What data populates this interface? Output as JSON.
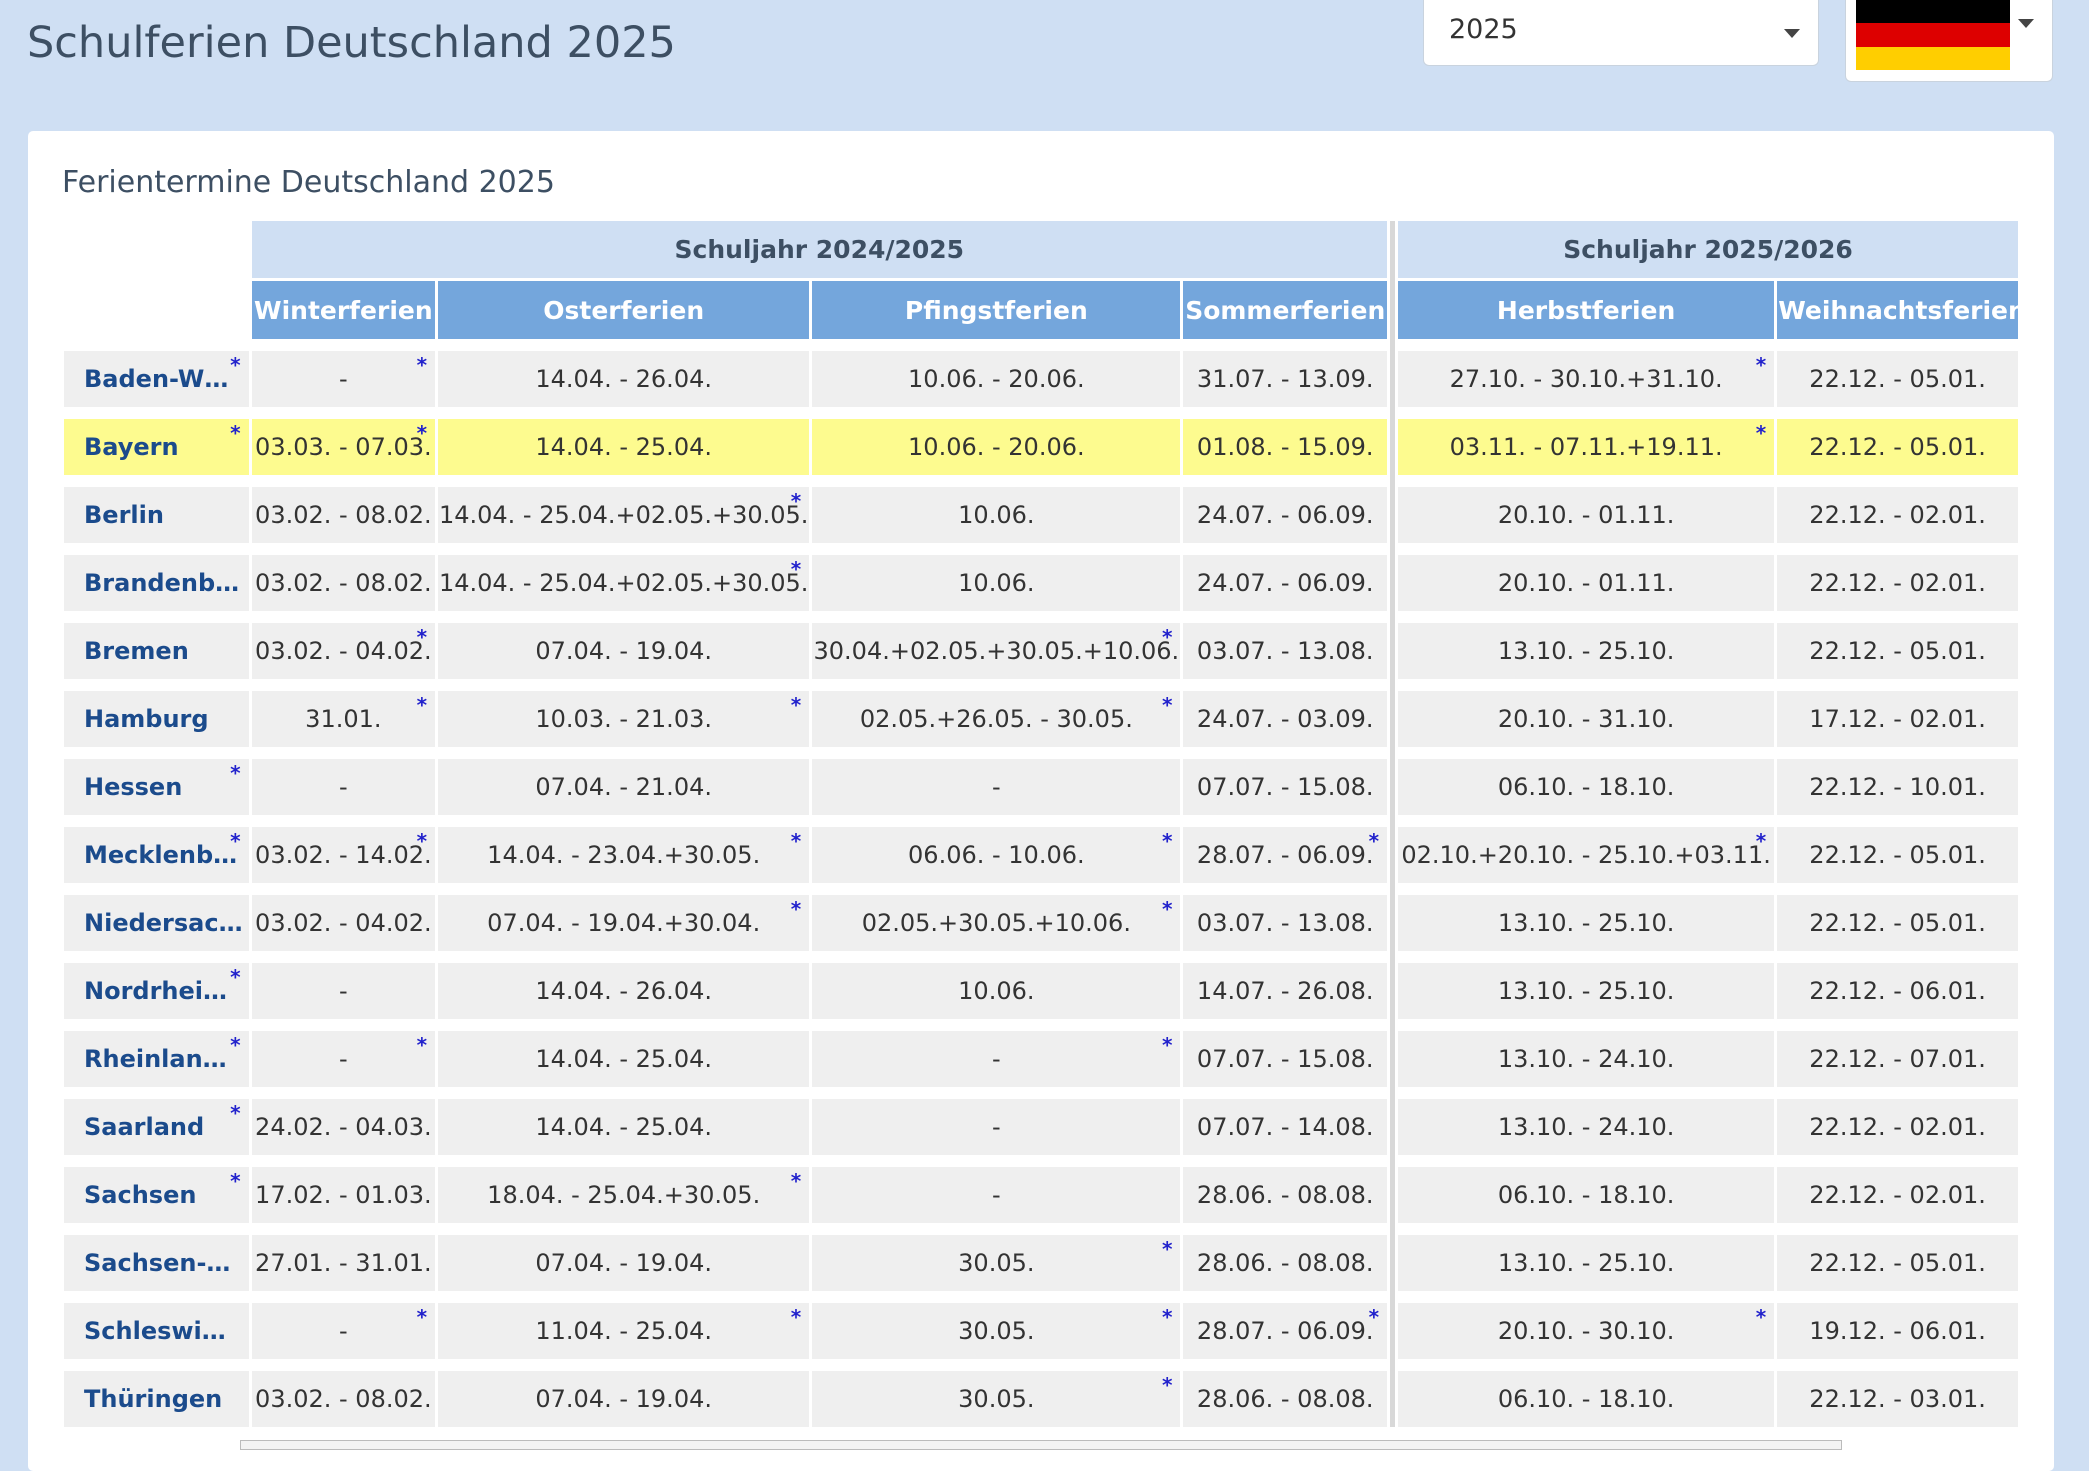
{
  "page": {
    "title": "Schulferien Deutschland 2025"
  },
  "controls": {
    "year_selected": "2025",
    "flag": {
      "colors": [
        "#000000",
        "#dd0000",
        "#ffce00"
      ]
    }
  },
  "panel": {
    "title": "Ferientermine Deutschland 2025"
  },
  "colors": {
    "header_blue": "#74a6dc",
    "year_header": "#cfdff3",
    "highlight": "#fdfb8f",
    "state_link": "#1b4b8c",
    "star": "#2222cc"
  },
  "table": {
    "year_headers": [
      "Schuljahr 2024/2025",
      "Schuljahr 2025/2026"
    ],
    "columns": [
      "Winterferien",
      "Osterferien",
      "Pfingstferien",
      "Sommerferien",
      "Herbstferien",
      "Weihnachtsferien"
    ],
    "rows": [
      {
        "state": "Baden-W…",
        "state_star": true,
        "highlight": false,
        "cells": [
          {
            "v": "-",
            "s": true
          },
          {
            "v": "14.04. - 26.04.",
            "s": false
          },
          {
            "v": "10.06. - 20.06.",
            "s": false
          },
          {
            "v": "31.07. - 13.09.",
            "s": false
          },
          {
            "v": "27.10. - 30.10.+31.10.",
            "s": true
          },
          {
            "v": "22.12. - 05.01.",
            "s": false
          }
        ]
      },
      {
        "state": "Bayern",
        "state_star": true,
        "highlight": true,
        "cells": [
          {
            "v": "03.03. - 07.03.",
            "s": true
          },
          {
            "v": "14.04. - 25.04.",
            "s": false
          },
          {
            "v": "10.06. - 20.06.",
            "s": false
          },
          {
            "v": "01.08. - 15.09.",
            "s": false
          },
          {
            "v": "03.11. - 07.11.+19.11.",
            "s": true
          },
          {
            "v": "22.12. - 05.01.",
            "s": false
          }
        ]
      },
      {
        "state": "Berlin",
        "state_star": false,
        "highlight": false,
        "cells": [
          {
            "v": "03.02. - 08.02.",
            "s": false
          },
          {
            "v": "14.04. - 25.04.+02.05.+30.05.",
            "s": true
          },
          {
            "v": "10.06.",
            "s": false
          },
          {
            "v": "24.07. - 06.09.",
            "s": false
          },
          {
            "v": "20.10. - 01.11.",
            "s": false
          },
          {
            "v": "22.12. - 02.01.",
            "s": false
          }
        ]
      },
      {
        "state": "Brandenb…",
        "state_star": false,
        "highlight": false,
        "cells": [
          {
            "v": "03.02. - 08.02.",
            "s": false
          },
          {
            "v": "14.04. - 25.04.+02.05.+30.05.",
            "s": true
          },
          {
            "v": "10.06.",
            "s": false
          },
          {
            "v": "24.07. - 06.09.",
            "s": false
          },
          {
            "v": "20.10. - 01.11.",
            "s": false
          },
          {
            "v": "22.12. - 02.01.",
            "s": false
          }
        ]
      },
      {
        "state": "Bremen",
        "state_star": false,
        "highlight": false,
        "cells": [
          {
            "v": "03.02. - 04.02.",
            "s": true
          },
          {
            "v": "07.04. - 19.04.",
            "s": false
          },
          {
            "v": "30.04.+02.05.+30.05.+10.06.",
            "s": true
          },
          {
            "v": "03.07. - 13.08.",
            "s": false
          },
          {
            "v": "13.10. - 25.10.",
            "s": false
          },
          {
            "v": "22.12. - 05.01.",
            "s": false
          }
        ]
      },
      {
        "state": "Hamburg",
        "state_star": false,
        "highlight": false,
        "cells": [
          {
            "v": "31.01.",
            "s": true
          },
          {
            "v": "10.03. - 21.03.",
            "s": true
          },
          {
            "v": "02.05.+26.05. - 30.05.",
            "s": true
          },
          {
            "v": "24.07. - 03.09.",
            "s": false
          },
          {
            "v": "20.10. - 31.10.",
            "s": false
          },
          {
            "v": "17.12. - 02.01.",
            "s": false
          }
        ]
      },
      {
        "state": "Hessen",
        "state_star": true,
        "highlight": false,
        "cells": [
          {
            "v": "-",
            "s": false
          },
          {
            "v": "07.04. - 21.04.",
            "s": false
          },
          {
            "v": "-",
            "s": false
          },
          {
            "v": "07.07. - 15.08.",
            "s": false
          },
          {
            "v": "06.10. - 18.10.",
            "s": false
          },
          {
            "v": "22.12. - 10.01.",
            "s": false
          }
        ]
      },
      {
        "state": "Mecklenb…",
        "state_star": true,
        "highlight": false,
        "cells": [
          {
            "v": "03.02. - 14.02.",
            "s": true
          },
          {
            "v": "14.04. - 23.04.+30.05.",
            "s": true
          },
          {
            "v": "06.06. - 10.06.",
            "s": true
          },
          {
            "v": "28.07. - 06.09.",
            "s": true
          },
          {
            "v": "02.10.+20.10. - 25.10.+03.11.",
            "s": true
          },
          {
            "v": "22.12. - 05.01.",
            "s": false
          }
        ]
      },
      {
        "state": "Niedersac…",
        "state_star": false,
        "highlight": false,
        "cells": [
          {
            "v": "03.02. - 04.02.",
            "s": false
          },
          {
            "v": "07.04. - 19.04.+30.04.",
            "s": true
          },
          {
            "v": "02.05.+30.05.+10.06.",
            "s": true
          },
          {
            "v": "03.07. - 13.08.",
            "s": false
          },
          {
            "v": "13.10. - 25.10.",
            "s": false
          },
          {
            "v": "22.12. - 05.01.",
            "s": false
          }
        ]
      },
      {
        "state": "Nordrhei…",
        "state_star": true,
        "highlight": false,
        "cells": [
          {
            "v": "-",
            "s": false
          },
          {
            "v": "14.04. - 26.04.",
            "s": false
          },
          {
            "v": "10.06.",
            "s": false
          },
          {
            "v": "14.07. - 26.08.",
            "s": false
          },
          {
            "v": "13.10. - 25.10.",
            "s": false
          },
          {
            "v": "22.12. - 06.01.",
            "s": false
          }
        ]
      },
      {
        "state": "Rheinlan…",
        "state_star": true,
        "highlight": false,
        "cells": [
          {
            "v": "-",
            "s": true
          },
          {
            "v": "14.04. - 25.04.",
            "s": false
          },
          {
            "v": "-",
            "s": true
          },
          {
            "v": "07.07. - 15.08.",
            "s": false
          },
          {
            "v": "13.10. - 24.10.",
            "s": false
          },
          {
            "v": "22.12. - 07.01.",
            "s": false
          }
        ]
      },
      {
        "state": "Saarland",
        "state_star": true,
        "highlight": false,
        "cells": [
          {
            "v": "24.02. - 04.03.",
            "s": false
          },
          {
            "v": "14.04. - 25.04.",
            "s": false
          },
          {
            "v": "-",
            "s": false
          },
          {
            "v": "07.07. - 14.08.",
            "s": false
          },
          {
            "v": "13.10. - 24.10.",
            "s": false
          },
          {
            "v": "22.12. - 02.01.",
            "s": false
          }
        ]
      },
      {
        "state": "Sachsen",
        "state_star": true,
        "highlight": false,
        "cells": [
          {
            "v": "17.02. - 01.03.",
            "s": false
          },
          {
            "v": "18.04. - 25.04.+30.05.",
            "s": true
          },
          {
            "v": "-",
            "s": false
          },
          {
            "v": "28.06. - 08.08.",
            "s": false
          },
          {
            "v": "06.10. - 18.10.",
            "s": false
          },
          {
            "v": "22.12. - 02.01.",
            "s": false
          }
        ]
      },
      {
        "state": "Sachsen-…",
        "state_star": false,
        "highlight": false,
        "cells": [
          {
            "v": "27.01. - 31.01.",
            "s": false
          },
          {
            "v": "07.04. - 19.04.",
            "s": false
          },
          {
            "v": "30.05.",
            "s": true
          },
          {
            "v": "28.06. - 08.08.",
            "s": false
          },
          {
            "v": "13.10. - 25.10.",
            "s": false
          },
          {
            "v": "22.12. - 05.01.",
            "s": false
          }
        ]
      },
      {
        "state": "Schleswi…",
        "state_star": false,
        "highlight": false,
        "cells": [
          {
            "v": "-",
            "s": true
          },
          {
            "v": "11.04. - 25.04.",
            "s": true
          },
          {
            "v": "30.05.",
            "s": true
          },
          {
            "v": "28.07. - 06.09.",
            "s": true
          },
          {
            "v": "20.10. - 30.10.",
            "s": true
          },
          {
            "v": "19.12. - 06.01.",
            "s": false
          }
        ]
      },
      {
        "state": "Thüringen",
        "state_star": false,
        "highlight": false,
        "cells": [
          {
            "v": "03.02. - 08.02.",
            "s": false
          },
          {
            "v": "07.04. - 19.04.",
            "s": false
          },
          {
            "v": "30.05.",
            "s": true
          },
          {
            "v": "28.06. - 08.08.",
            "s": false
          },
          {
            "v": "06.10. - 18.10.",
            "s": false
          },
          {
            "v": "22.12. - 03.01.",
            "s": false
          }
        ]
      }
    ]
  }
}
